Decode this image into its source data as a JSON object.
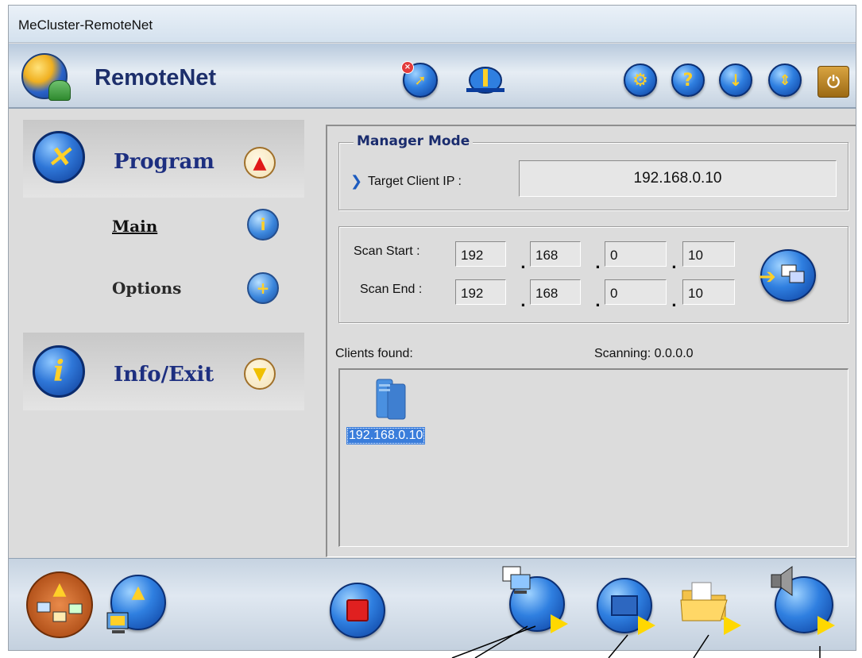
{
  "window": {
    "title": "MeCluster-RemoteNet"
  },
  "app": {
    "name": "RemoteNet"
  },
  "toolbar": {
    "icons": [
      "connect-disconnect-icon",
      "network-icon",
      "settings-icon",
      "help-icon",
      "download-icon",
      "updown-icon",
      "power-icon"
    ]
  },
  "sidebar": {
    "program": {
      "label": "Program"
    },
    "items": [
      {
        "label": "Main"
      },
      {
        "label": "Options"
      }
    ],
    "info_exit": {
      "label": "Info/Exit"
    }
  },
  "manager": {
    "group_title": "Manager Mode",
    "target_label": "Target Client IP :",
    "target_value": "192.168.0.10"
  },
  "scan": {
    "start_label": "Scan Start :",
    "end_label": "Scan End :",
    "start": [
      "192",
      "168",
      "0",
      "10"
    ],
    "end": [
      "192",
      "168",
      "0",
      "10"
    ]
  },
  "clients": {
    "found_label": "Clients found:",
    "scanning_label": "Scanning: 0.0.0.0",
    "items": [
      {
        "ip": "192.168.0.10"
      }
    ]
  },
  "colors": {
    "accent_blue": "#2f7fe0",
    "title_navy": "#1d2f80",
    "play_yellow": "#ffd800",
    "stop_red": "#e02020",
    "selection": "#3a7ddb"
  }
}
